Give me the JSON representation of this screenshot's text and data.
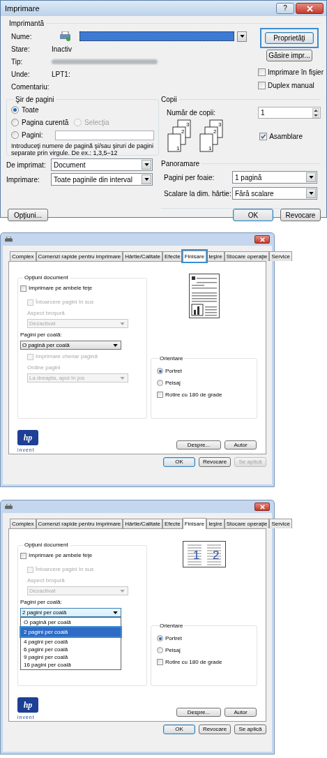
{
  "print_dialog": {
    "title": "Imprimare",
    "help": "?",
    "printer": {
      "legend": "Imprimantă",
      "name_label": "Nume:",
      "status_label": "Stare:",
      "status": "Inactiv",
      "type_label": "Tip:",
      "where_label": "Unde:",
      "where": "LPT1:",
      "comment_label": "Comentariu:"
    },
    "properties_button": {
      "label": "Proprietăţi",
      "highlighted": true
    },
    "find_button": "Găsire impr...",
    "print_to_file": {
      "label": "Imprimare în fişier",
      "checked": false
    },
    "manual_duplex": {
      "label": "Duplex manual",
      "checked": false
    },
    "page_range": {
      "legend": "Şir de pagini",
      "options": [
        {
          "label": "Toate",
          "selected": true,
          "disabled": false
        },
        {
          "label": "Pagina curentă",
          "selected": false,
          "disabled": false
        },
        {
          "label": "Selecţia",
          "selected": false,
          "disabled": true
        },
        {
          "label": "Pagini:",
          "selected": false,
          "disabled": false
        }
      ],
      "hint": "Introduceţi numere de pagină şi/sau şiruri de pagini separate prin virgule.  De ex.: 1,3,5–12"
    },
    "copies": {
      "legend": "Copii",
      "label": "Număr de copii:",
      "value": "1",
      "collate": {
        "label": "Asamblare",
        "checked": true
      },
      "stacks": [
        [
          "1",
          "2",
          "3"
        ],
        [
          "1",
          "2",
          "3"
        ]
      ]
    },
    "print_what": {
      "label": "De imprimat:",
      "value": "Document"
    },
    "print_scope": {
      "label": "Imprimare:",
      "value": "Toate paginile din interval"
    },
    "zoom": {
      "legend": "Panoramare",
      "pages_label": "Pagini per foaie:",
      "pages_value": "1 pagină",
      "scale_label": "Scalare la dim. hârtie:",
      "scale_value": "Fără scalare"
    },
    "options_button": "Opţiuni...",
    "ok": "OK",
    "cancel": "Revocare"
  },
  "properties_dialogs": [
    {
      "tabs": [
        {
          "label": "Complex",
          "selected": false,
          "highlighted": false
        },
        {
          "label": "Comenzi rapide pentru imprimare",
          "selected": false,
          "highlighted": false
        },
        {
          "label": "Hârtie/Calitate",
          "selected": false,
          "highlighted": false
        },
        {
          "label": "Efecte",
          "selected": false,
          "highlighted": false
        },
        {
          "label": "Finisare",
          "selected": true,
          "highlighted": true
        },
        {
          "label": "Ieşire",
          "selected": false,
          "highlighted": false
        },
        {
          "label": "Stocare operaţie",
          "selected": false,
          "highlighted": false
        },
        {
          "label": "Service",
          "selected": false,
          "highlighted": false
        }
      ],
      "document_options": {
        "legend": "Opţiuni document",
        "duplex": {
          "label": "Imprimare pe ambele feţe",
          "checked": false
        },
        "flip": {
          "label": "Întoarcere pagini în sus",
          "checked": false,
          "disabled": true
        },
        "booklet": {
          "label": "Aspect broşură",
          "value": "Dezactivat",
          "disabled": true
        },
        "pages_per_sheet": {
          "label": "Pagini per coală:",
          "value": "O pagină per coală",
          "open": false
        },
        "page_border": {
          "label": "Imprimare chenar pagină",
          "checked": false,
          "disabled": true
        },
        "page_order": {
          "label": "Ordine pagini",
          "value": "La dreapta, apoi în jos",
          "disabled": true
        }
      },
      "preview": {
        "kind": "single"
      },
      "orientation": {
        "legend": "Orientare",
        "options": [
          {
            "label": "Portret",
            "selected": true
          },
          {
            "label": "Peisaj",
            "selected": false
          }
        ],
        "rotate": {
          "label": "Rotire cu 180 de grade",
          "checked": false
        }
      },
      "logo": {
        "mark": "hp",
        "tagline": "invent"
      },
      "about": "Despre...",
      "author": "Autor",
      "ok": "OK",
      "cancel": "Revocare",
      "apply": {
        "label": "Se aplică",
        "disabled": true
      }
    },
    {
      "tabs": [
        {
          "label": "Complex",
          "selected": false,
          "highlighted": false
        },
        {
          "label": "Comenzi rapide pentru imprimare",
          "selected": false,
          "highlighted": false
        },
        {
          "label": "Hârtie/Calitate",
          "selected": false,
          "highlighted": false
        },
        {
          "label": "Efecte",
          "selected": false,
          "highlighted": false
        },
        {
          "label": "Finisare",
          "selected": true,
          "highlighted": false
        },
        {
          "label": "Ieşire",
          "selected": false,
          "highlighted": false
        },
        {
          "label": "Stocare operaţie",
          "selected": false,
          "highlighted": false
        },
        {
          "label": "Service",
          "selected": false,
          "highlighted": false
        }
      ],
      "document_options": {
        "legend": "Opţiuni document",
        "duplex": {
          "label": "Imprimare pe ambele feţe",
          "checked": false
        },
        "flip": {
          "label": "Întoarcere pagini în sus",
          "checked": false,
          "disabled": true
        },
        "booklet": {
          "label": "Aspect broşură",
          "value": "Dezactivat",
          "disabled": true
        },
        "pages_per_sheet": {
          "label": "Pagini per coală:",
          "value": "2 pagini per coală",
          "open": true,
          "items": [
            {
              "label": "O pagină per coală",
              "selected": false,
              "highlighted": false
            },
            {
              "label": "2 pagini per coală",
              "selected": true,
              "highlighted": true
            },
            {
              "label": "4 pagini per coală",
              "selected": false,
              "highlighted": false
            },
            {
              "label": "6 pagini per coală",
              "selected": false,
              "highlighted": false
            },
            {
              "label": "9 pagini per coală",
              "selected": false,
              "highlighted": false
            },
            {
              "label": "16 pagini per coală",
              "selected": false,
              "highlighted": false
            }
          ]
        }
      },
      "preview": {
        "kind": "double",
        "numbers": [
          "1",
          "2"
        ]
      },
      "orientation": {
        "legend": "Orientare",
        "options": [
          {
            "label": "Portret",
            "selected": true
          },
          {
            "label": "Peisaj",
            "selected": false
          }
        ],
        "rotate": {
          "label": "Rotire cu 180 de grade",
          "checked": false
        }
      },
      "logo": {
        "mark": "hp",
        "tagline": "invent"
      },
      "about": "Despre...",
      "author": "Autor",
      "ok": "OK",
      "cancel": "Revocare",
      "apply": {
        "label": "Se aplică",
        "disabled": false
      }
    }
  ]
}
